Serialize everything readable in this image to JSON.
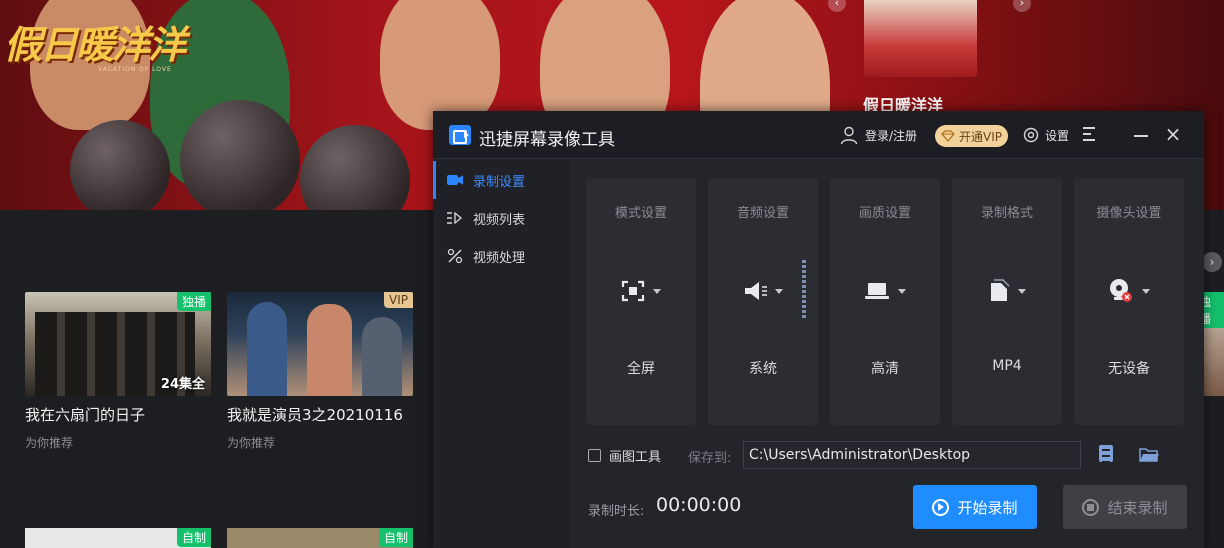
{
  "background": {
    "banner": {
      "logo_text": "假日暖洋洋",
      "logo_subtext": "VACATION OF LOVE",
      "thumb_title": "假日暖洋洋",
      "prev_arrow": "‹",
      "next_arrow": "›"
    },
    "row_next_arrow": "›",
    "cards": [
      {
        "title": "我在六扇门的日子",
        "subtitle": "为你推荐",
        "badge": "独播",
        "episodes": "24集全"
      },
      {
        "title": "我就是演员3之20210116",
        "subtitle": "为你推荐",
        "badge": "VIP",
        "episodes": ""
      }
    ],
    "partial_cards": [
      {
        "badge": "独播"
      },
      {
        "badge": "自制"
      },
      {
        "badge": "自制"
      }
    ]
  },
  "recorder": {
    "title": "迅捷屏幕录像工具",
    "login_label": "登录/注册",
    "vip_label": "开通VIP",
    "settings_label": "设置",
    "sidebar": [
      {
        "label": "录制设置",
        "icon": "camera-icon",
        "active": true
      },
      {
        "label": "视频列表",
        "icon": "playlist-icon",
        "active": false
      },
      {
        "label": "视频处理",
        "icon": "tools-icon",
        "active": false
      }
    ],
    "panels": [
      {
        "title": "模式设置",
        "value": "全屏",
        "icon": "fullscreen-icon"
      },
      {
        "title": "音频设置",
        "value": "系统",
        "icon": "speaker-icon"
      },
      {
        "title": "画质设置",
        "value": "高清",
        "icon": "laptop-icon"
      },
      {
        "title": "录制格式",
        "value": "MP4",
        "icon": "file-icon"
      },
      {
        "title": "摄像头设置",
        "value": "无设备",
        "icon": "webcam-icon"
      }
    ],
    "draw_tool_label": "画图工具",
    "save_to_label": "保存到:",
    "save_path": "C:\\Users\\Administrator\\Desktop",
    "duration_label": "录制时长:",
    "duration_value": "00:00:00",
    "start_button": "开始录制",
    "stop_button": "结束录制",
    "accent_color": "#1f8dff",
    "vip_color": "#f1d29b"
  }
}
